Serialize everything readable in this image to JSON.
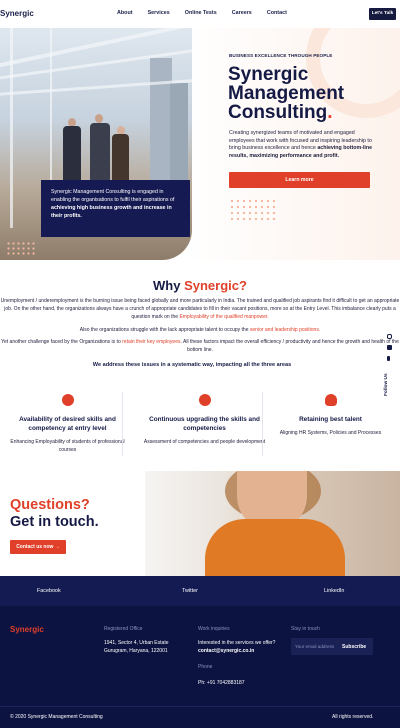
{
  "nav": {
    "logo": "Synergic",
    "links": [
      "About",
      "Services",
      "Online Tests",
      "Careers",
      "Contact"
    ],
    "cta": "Let's Talk"
  },
  "hero": {
    "eyebrow": "BUSINESS EXCELLENCE THROUGH PEOPLE",
    "title_line1": "Synergic",
    "title_line2": "Management",
    "title_line3": "Consulting",
    "title_dot": ".",
    "desc_plain": "Creating synergized teams of motivated and engaged employees that work with focused and inspiring leadership to bring business excellence and hence ",
    "desc_bold": "achieving bottom-line results, maximizing performance and profit.",
    "button": "Learn more",
    "card_plain": "Synergic Management Consulting is engaged in enabling the organisations to fulfil their aspirations of ",
    "card_bold": "achieving high business growth and increase in their profits."
  },
  "why": {
    "title_plain": "Why ",
    "title_accent": "Synergic?",
    "p1": "Unemployment / underemployment is the burning issue being faced globally and more particularly in India. The trained and qualified job aspirants find it difficult to get an appropriate job. On the other hand, the organizations always have a crunch of appropriate candidates to fill in their vacant positions, more so at the Entry Level. This imbalance clearly puts a question mark on the ",
    "p1_hl": "Employability of the qualified manpower.",
    "p2": "Also the organizations struggle with the lack appropriate talent to occupy the ",
    "p2_hl": "senior and leadership positions.",
    "p3a": "Yet another challenge faced by the Organizations is to ",
    "p3_hl": "retain their key employees",
    "p3b": ". All these factors impact the overall efficiency / productivity and hence the growth and health of the bottom line.",
    "address": "We address these issues in a systematic way, impacting all the three areas"
  },
  "features": [
    {
      "icon": "brain-icon",
      "title": "Availability of desired skills and competency at entry level",
      "desc": "Enhancing Employability of students of professional courses"
    },
    {
      "icon": "gear-growth-icon",
      "title": "Continuous upgrading the skills and competencies",
      "desc": "Assessment of competencies and people development"
    },
    {
      "icon": "award-icon",
      "title": "Retaining best talent",
      "desc": "Aligning HR Systems, Policies and Processes"
    }
  ],
  "follow": "Follow Us",
  "questions": {
    "title": "Questions?",
    "subtitle": "Get in touch.",
    "button": "Contact us now"
  },
  "strip": [
    "Facebook",
    "Twitter",
    "LinkedIn"
  ],
  "footer": {
    "logo": "Synergic",
    "office_head": "Registered Office",
    "office_l1": "1941, Sector 4, Urban Estate",
    "office_l2": "Gurugram, Haryana, 122001",
    "work_head": "Work inquiries",
    "work_l1": "Interested in the services we offer?",
    "work_email": "contact@synergic.co.in",
    "phone_head": "Phone",
    "phone": "Ph: +91 7042883187",
    "stay_head": "Stay in touch",
    "email_placeholder": "Your email address",
    "subscribe": "Subscribe",
    "copyright": "© 2020 Synergic Management Consulting",
    "rights": "All rights reserved."
  },
  "colors": {
    "accent": "#e0402a",
    "navy": "#151a45",
    "footer": "#0d1340"
  }
}
